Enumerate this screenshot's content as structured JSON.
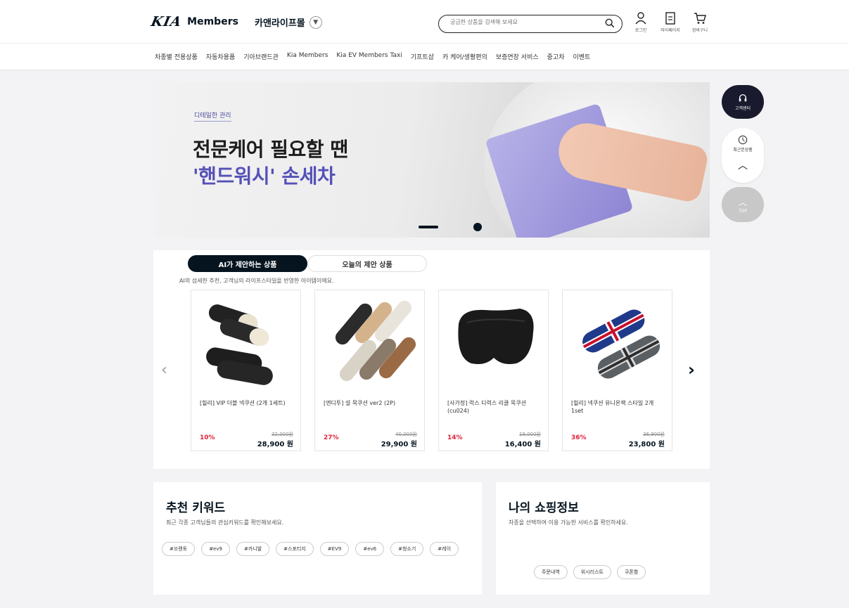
{
  "header": {
    "logo_mark": "KIA",
    "logo_text": "Members",
    "mall_name": "카앤라이프몰",
    "search_placeholder": "궁금한 상품을 검색해 보세요",
    "icons": [
      {
        "name": "login-icon",
        "label": "로그인"
      },
      {
        "name": "mypage-icon",
        "label": "마이페이지"
      },
      {
        "name": "cart-icon",
        "label": "장바구니"
      }
    ]
  },
  "nav": {
    "items": [
      "차종별 전용상품",
      "자동차용품",
      "기아브랜드관",
      "Kia Members",
      "Kia EV Members Taxi",
      "기프트샵",
      "카 케어/생활편의",
      "보증연장 서비스",
      "중고차",
      "이벤트"
    ]
  },
  "banner": {
    "tag": "디테일한 관리",
    "title_line1": "전문케어 필요할 땐",
    "title_line2": "'핸드워시' 손세차"
  },
  "side": {
    "cs_label": "고객센터",
    "recent_label": "최근본상품",
    "top_label": "TOP"
  },
  "recommend": {
    "tab_active": "AI가 제안하는 상품",
    "tab_inactive": "오늘의 제안 상품",
    "description": "AI의 섬세한 추천, 고객님의 라이프스타일을 반영한 아이템이에요.",
    "products": [
      {
        "name": "[힐리] VIP 더블 넥쿠션 (2개 1세트)",
        "discount": "10%",
        "original_price": "32,000원",
        "price": "28,900 원"
      },
      {
        "name": "[엔디투] 설 목쿠션 ver2 (2P)",
        "discount": "27%",
        "original_price": "40,000원",
        "price": "29,900 원"
      },
      {
        "name": "[사가정] 럭스 디럭스 리클 목쿠션 (cu024)",
        "discount": "14%",
        "original_price": "19,000원",
        "price": "16,400 원"
      },
      {
        "name": "[힐리] 넥쿠션 유니온잭 스타일 2개 1set",
        "discount": "36%",
        "original_price": "36,900원",
        "price": "23,800 원"
      }
    ]
  },
  "keywords": {
    "title": "추천 키워드",
    "description": "최근 각종 고객님들의 관심키워드를 확인해보세요.",
    "chips": [
      "#쏘렌토",
      "#ev9",
      "#카니발",
      "#스포티지",
      "#EV9",
      "#ev6",
      "#청소기",
      "#레이"
    ]
  },
  "shopping": {
    "title": "나의 쇼핑정보",
    "description": "차종을 선택하여 이용 가능한 서비스를 확인하세요.",
    "chips": [
      "주문내역",
      "위시리스트",
      "쿠폰함"
    ]
  },
  "colors": {
    "brand_dark": "#05141f",
    "accent_purple": "#5551b8",
    "discount_red": "#e2233b"
  }
}
